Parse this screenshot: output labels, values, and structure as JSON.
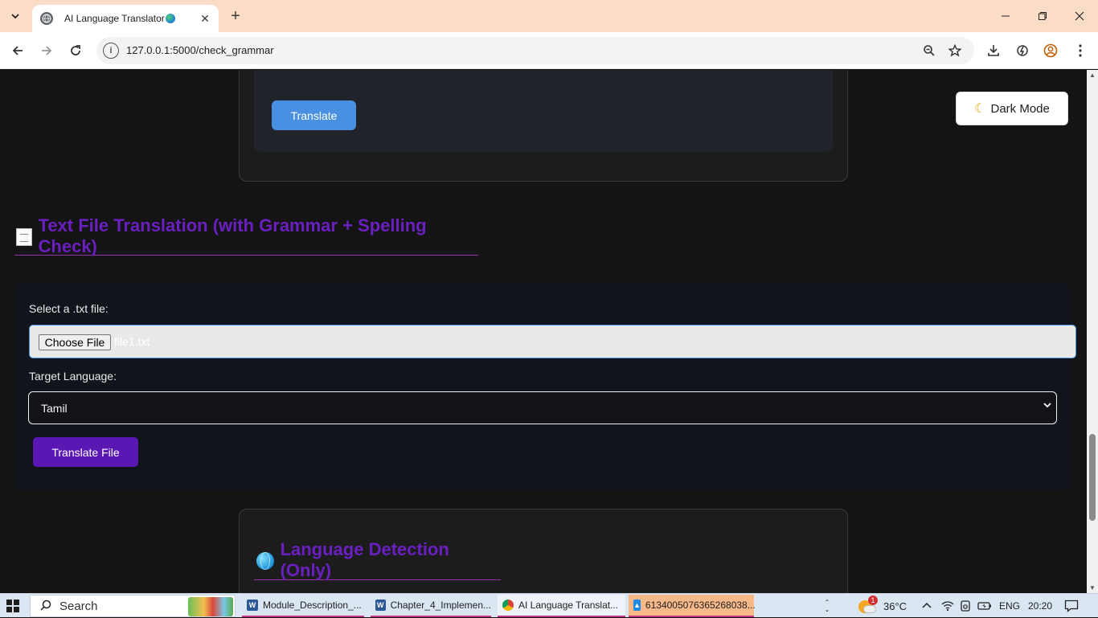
{
  "browser": {
    "tab_title": "AI Language Translator",
    "new_tab_label": "+",
    "url": "127.0.0.1:5000/check_grammar"
  },
  "page": {
    "translate_button": "Translate",
    "dark_mode_button": "Dark Mode",
    "file_section": {
      "heading": "Text File Translation (with Grammar + Spelling Check)",
      "select_label": "Select a .txt file:",
      "choose_file_button": "Choose File",
      "file_name": "file1.txt",
      "target_language_label": "Target Language:",
      "target_language_value": "Tamil",
      "translate_file_button": "Translate File"
    },
    "detection_section": {
      "heading": "Language Detection (Only)"
    }
  },
  "taskbar": {
    "search_placeholder": "Search",
    "apps": [
      {
        "label": "Module_Description_...",
        "icon": "word-icon"
      },
      {
        "label": "Chapter_4_Implemen...",
        "icon": "word-icon"
      },
      {
        "label": "AI Language Translat...",
        "icon": "chrome-icon"
      },
      {
        "label": "6134005076365268038...",
        "icon": "image-viewer-icon"
      }
    ],
    "weather": "36°C",
    "weather_badge": "1",
    "language": "ENG",
    "time": "20:20"
  },
  "colors": {
    "accent_purple": "#6a1fc0",
    "button_blue": "#4a90e2",
    "button_purple": "#5b17b4",
    "tab_strip": "#fbdcc6"
  }
}
